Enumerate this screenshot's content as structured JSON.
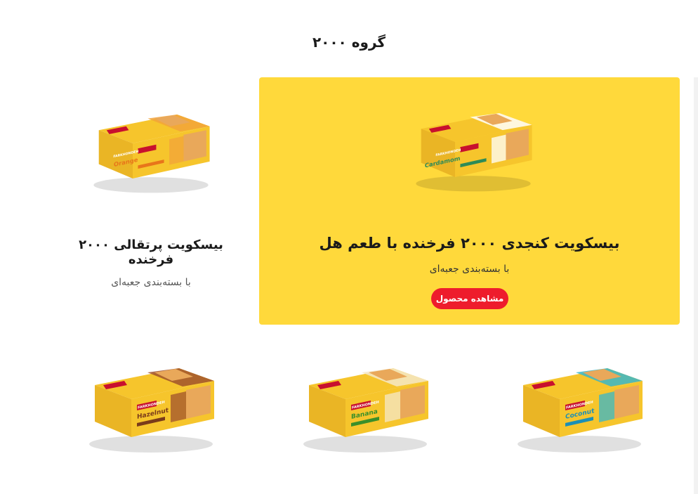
{
  "page": {
    "title": "گروه ۲۰۰۰"
  },
  "featured": {
    "title": "بیسکویت کنجدی ۲۰۰۰ فرخنده با طعم هل",
    "subtitle": "با بسته‌بندی جعبه‌ای",
    "button_label": "مشاهده محصول",
    "box": {
      "brand": "FARKHONDEH",
      "flavor": "Cardamom",
      "accent": "#2e8b57",
      "band": "#ffffff"
    }
  },
  "side_product": {
    "title": "بیسکویت پرتقالی ۲۰۰۰ فرخنده",
    "subtitle": "با بسته‌بندی جعبه‌ای",
    "box": {
      "brand": "FARKHONDEH",
      "flavor": "Orange",
      "accent": "#e8751a",
      "band": "#f2a33a"
    }
  },
  "grid_products": [
    {
      "box": {
        "brand": "FARKHONDEH",
        "flavor": "Hazelnut",
        "accent": "#7a3b1a",
        "band": "#a0522d"
      }
    },
    {
      "box": {
        "brand": "FARKHONDEH",
        "flavor": "Banana",
        "accent": "#3a8f2a",
        "band": "#f4e7c8"
      }
    },
    {
      "box": {
        "brand": "FARKHONDEH",
        "flavor": "Coconut",
        "accent": "#1d8fb5",
        "band": "#38b6c9"
      }
    }
  ],
  "colors": {
    "featured_bg": "#ffd93b",
    "button": "#ee1c2c",
    "box_yellow": "#f6c52c",
    "brand_red": "#c8102e"
  }
}
